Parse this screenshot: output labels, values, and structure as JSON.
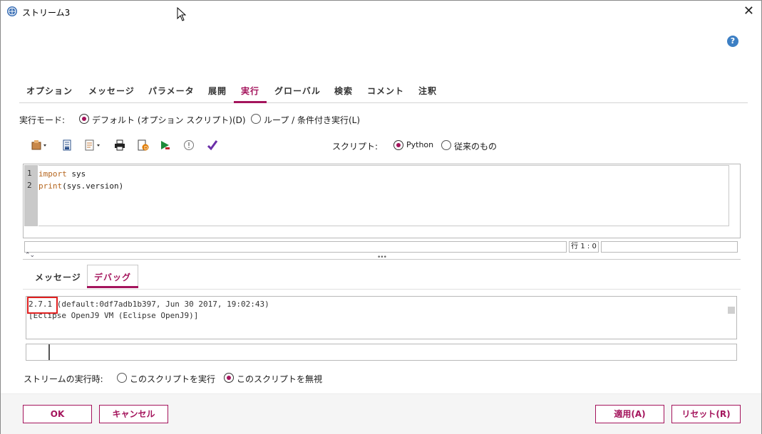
{
  "window": {
    "title": "ストリーム3",
    "close_label": "✕"
  },
  "tabs": [
    {
      "label": "オプション"
    },
    {
      "label": "メッセージ"
    },
    {
      "label": "パラメータ"
    },
    {
      "label": "展開"
    },
    {
      "label": "実行"
    },
    {
      "label": "グローバル"
    },
    {
      "label": "検索"
    },
    {
      "label": "コメント"
    },
    {
      "label": "注釈"
    }
  ],
  "active_tab": "実行",
  "execution_mode": {
    "label": "実行モード:",
    "options": [
      "デフォルト (オプション スクリプト)(D)",
      "ループ / 条件付き実行(L)"
    ],
    "selected": "デフォルト (オプション スクリプト)(D)"
  },
  "script_lang": {
    "label": "スクリプト:",
    "options": [
      "Python",
      "従来のもの"
    ],
    "selected": "Python"
  },
  "toolbar_icons": [
    "import-script-icon",
    "save-script-icon",
    "edit-script-icon",
    "print-icon",
    "debug-icon",
    "run-icon",
    "check-syntax-icon",
    "validate-icon"
  ],
  "editor": {
    "line_numbers": [
      "1",
      "2"
    ],
    "lines": [
      {
        "keyword": "import",
        "rest": " sys"
      },
      {
        "keyword": "print",
        "rest": "(sys.version)"
      }
    ],
    "position_label": "行 1 : 0"
  },
  "subtabs": [
    {
      "label": "メッセージ"
    },
    {
      "label": "デバッグ"
    }
  ],
  "active_subtab": "デバッグ",
  "debug_output": {
    "version": "2.7.1",
    "line1_rest": " (default:0df7adb1b397, Jun 30 2017, 19:02:43)",
    "line2": "[Eclipse OpenJ9 VM (Eclipse OpenJ9)]"
  },
  "stream_run": {
    "label": "ストリームの実行時:",
    "options": [
      "このスクリプトを実行",
      "このスクリプトを無視"
    ],
    "selected": "このスクリプトを無視"
  },
  "buttons": {
    "ok": "OK",
    "cancel": "キャンセル",
    "apply": "適用(A)",
    "reset": "リセット(R)"
  },
  "colors": {
    "accent": "#a4145c",
    "help": "#3c7fc4",
    "highlight": "#e02020"
  }
}
